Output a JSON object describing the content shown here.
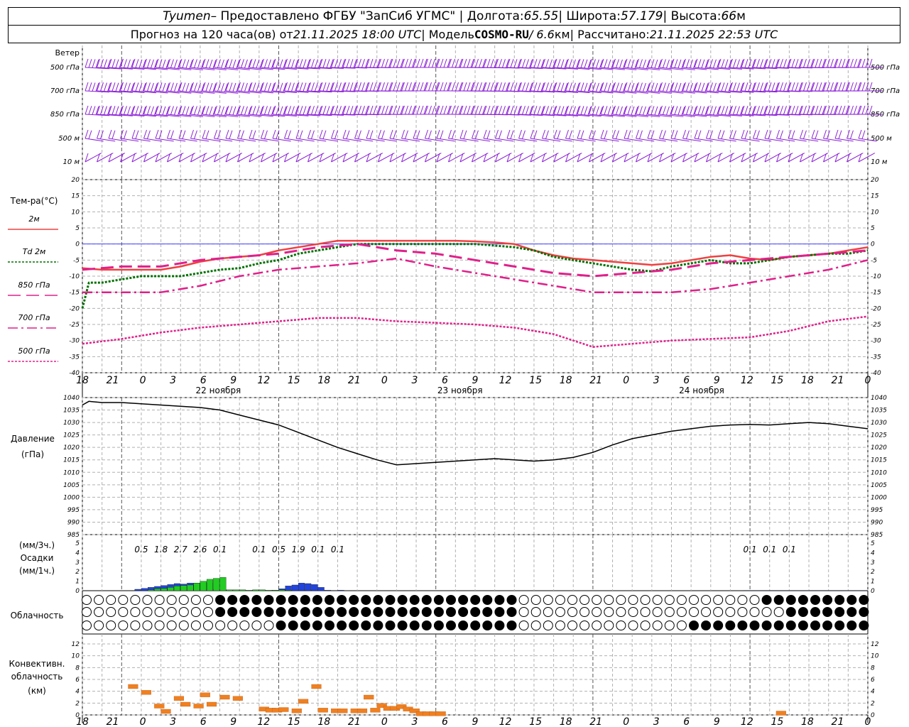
{
  "header": {
    "station": "Tyumen",
    "sep1": " – Предоставлено ФГБУ \"ЗапСиб УГМС\" | Долгота: ",
    "lon": "65.55",
    "sep2": " | Широта: ",
    "lat": "57.179",
    "sep3": " | Высота: ",
    "alt": "66",
    "alt_unit": "м",
    "fc_prefix": "Прогноз на 120 часа(ов) от ",
    "fc_time": "21.11.2025 18:00 UTC",
    "model_prefix": " | Модель ",
    "model": "COSMO-RU",
    "model_res": " / 6.6",
    "model_res_unit": "км",
    "calc_prefix": " | Рассчитано: ",
    "calc_time": "21.11.2025 22:53 UTC"
  },
  "wind_panel": {
    "title": "Ветер",
    "levels": [
      "500 гПа",
      "700 гПа",
      "850 гПа",
      "500 м",
      "10 м"
    ],
    "barb_color": "#8b1fd6"
  },
  "temp_panel": {
    "title": "Тем-ра(°C)",
    "legend": [
      "2м",
      "Td  2м",
      "850 гПа",
      "700 гПа",
      "500 гПа"
    ],
    "yticks": [
      "20",
      "15",
      "10",
      "5",
      "0",
      "-5",
      "-10",
      "-15",
      "-20",
      "-25",
      "-30",
      "-35",
      "-40"
    ]
  },
  "time_axis": {
    "hours": [
      "18",
      "21",
      "0",
      "3",
      "6",
      "9",
      "12",
      "15",
      "18",
      "21",
      "0",
      "3",
      "6",
      "9",
      "12",
      "15",
      "18",
      "21",
      "0",
      "3",
      "6",
      "9",
      "12",
      "15",
      "18",
      "21",
      "0"
    ],
    "days": [
      "22 ноября",
      "23 ноября",
      "24 ноября"
    ]
  },
  "pressure_panel": {
    "title": "Давление",
    "unit": "(гПа)",
    "yticks": [
      "1040",
      "1035",
      "1030",
      "1025",
      "1020",
      "1015",
      "1010",
      "1005",
      "1000",
      "995",
      "990",
      "985"
    ]
  },
  "precip_panel": {
    "unit_3h": "(мм/3ч.)",
    "title": "Осадки",
    "unit_1h": "(мм/1ч.)",
    "yticks": [
      "5",
      "4",
      "3",
      "2",
      "1",
      "0"
    ],
    "totals": [
      {
        "hour": 9,
        "text": "0.5"
      },
      {
        "hour": 12,
        "text": "1.8"
      },
      {
        "hour": 15,
        "text": "2.7"
      },
      {
        "hour": 18,
        "text": "2.6"
      },
      {
        "hour": 21,
        "text": "0.1"
      },
      {
        "hour": 27,
        "text": "0.1"
      },
      {
        "hour": 30,
        "text": "0.5"
      },
      {
        "hour": 33,
        "text": "1.9"
      },
      {
        "hour": 36,
        "text": "0.1"
      },
      {
        "hour": 39,
        "text": "0.1"
      },
      {
        "hour": 102,
        "text": "0.1"
      },
      {
        "hour": 105,
        "text": "0.1"
      },
      {
        "hour": 108,
        "text": "0.1"
      }
    ]
  },
  "cloud_panel": {
    "title": "Облачность"
  },
  "conv_panel": {
    "title_1": "Конвективн.",
    "title_2": "облачность",
    "unit": "(км)",
    "yticks": [
      "12",
      "10",
      "8",
      "6",
      "4",
      "2",
      "0"
    ]
  },
  "colors": {
    "t2m": "#f04040",
    "td2m": "#007000",
    "t850": "#e0208a",
    "t700": "#e0208a",
    "t500": "#e0208a",
    "zero_line": "#4040ff",
    "precip_green": "#22cc22",
    "precip_blue": "#2244dd",
    "conv": "#f08020",
    "grid": "#b0b0b0"
  },
  "chart_data": [
    {
      "type": "line",
      "title": "Тем-ра(°C)",
      "x_unit": "hours since 21.11.2025 18:00 UTC",
      "ylim": [
        -40,
        20
      ],
      "series": [
        {
          "name": "2м",
          "x": [
            0,
            3,
            6,
            9,
            12,
            15,
            18,
            21,
            24,
            27,
            30,
            33,
            36,
            39,
            42,
            45,
            48,
            51,
            54,
            57,
            60,
            63,
            66,
            69,
            72,
            75,
            78,
            81,
            84,
            87,
            90,
            93,
            96,
            99,
            102,
            105,
            108,
            111,
            114,
            117,
            120
          ],
          "values": [
            -7.5,
            -8,
            -8,
            -8,
            -8,
            -7,
            -5.5,
            -4.5,
            -4,
            -3.5,
            -2,
            -1,
            0,
            1,
            1,
            1,
            1,
            1,
            1,
            1,
            0.8,
            0.5,
            0,
            -2,
            -3.5,
            -4.5,
            -5,
            -5.5,
            -6,
            -6.5,
            -6,
            -5,
            -4,
            -3.5,
            -4.5,
            -5,
            -4,
            -3.5,
            -3,
            -2,
            -1
          ]
        },
        {
          "name": "Td  2м",
          "x": [
            0,
            1,
            3,
            6,
            9,
            12,
            15,
            18,
            21,
            24,
            27,
            30,
            33,
            36,
            39,
            42,
            45,
            48,
            51,
            54,
            57,
            60,
            63,
            66,
            69,
            72,
            75,
            78,
            81,
            84,
            87,
            90,
            93,
            96,
            99,
            102,
            105,
            108,
            111,
            114,
            117,
            120
          ],
          "values": [
            -20,
            -12,
            -12,
            -11,
            -10,
            -10,
            -10,
            -9,
            -8,
            -7.5,
            -6,
            -5,
            -3,
            -2,
            -1,
            0,
            0,
            0,
            0,
            0,
            0,
            0,
            -0.5,
            -1,
            -2,
            -4,
            -5,
            -6,
            -7,
            -8,
            -8.5,
            -7,
            -6,
            -5,
            -6,
            -6,
            -5,
            -4,
            -3.5,
            -3,
            -3,
            -2
          ]
        },
        {
          "name": "850 гПа",
          "x": [
            0,
            6,
            12,
            18,
            24,
            30,
            36,
            42,
            48,
            54,
            60,
            66,
            72,
            78,
            84,
            90,
            96,
            102,
            108,
            114,
            120
          ],
          "values": [
            -8,
            -7,
            -7,
            -5,
            -4,
            -3,
            -1,
            0,
            -2,
            -3,
            -5,
            -7,
            -9,
            -10,
            -9,
            -8,
            -6,
            -5,
            -4,
            -3,
            -2
          ]
        },
        {
          "name": "700 гПа",
          "x": [
            0,
            6,
            12,
            18,
            24,
            30,
            36,
            42,
            48,
            54,
            60,
            66,
            72,
            78,
            84,
            90,
            96,
            102,
            108,
            114,
            120
          ],
          "values": [
            -15,
            -15,
            -15,
            -13,
            -10,
            -8,
            -7,
            -6,
            -4.5,
            -7,
            -9,
            -11,
            -13,
            -15,
            -15,
            -15,
            -14,
            -12,
            -10,
            -8,
            -5
          ]
        },
        {
          "name": "500 гПа",
          "x": [
            0,
            6,
            12,
            18,
            24,
            30,
            36,
            42,
            48,
            54,
            60,
            66,
            72,
            78,
            84,
            90,
            96,
            102,
            108,
            114,
            120
          ],
          "values": [
            -31,
            -29.5,
            -27.5,
            -26,
            -25,
            -24,
            -23,
            -23,
            -24,
            -24.5,
            -25,
            -26,
            -28,
            -32,
            -31,
            -30,
            -29.5,
            -29,
            -27,
            -24,
            -22.5
          ]
        }
      ]
    },
    {
      "type": "line",
      "title": "Давление",
      "ylabel": "(гПа)",
      "x_unit": "hours since 21.11.2025 18:00 UTC",
      "ylim": [
        985,
        1040
      ],
      "series": [
        {
          "name": "",
          "x": [
            0,
            1,
            3,
            6,
            9,
            12,
            15,
            18,
            21,
            24,
            27,
            30,
            33,
            36,
            39,
            42,
            45,
            48,
            51,
            54,
            57,
            60,
            63,
            66,
            69,
            72,
            75,
            78,
            81,
            84,
            87,
            90,
            93,
            96,
            99,
            102,
            105,
            108,
            111,
            114,
            117,
            120
          ],
          "values": [
            1037,
            1038.5,
            1038,
            1038,
            1037.5,
            1037,
            1036.5,
            1036,
            1035,
            1033,
            1031,
            1029,
            1026,
            1023,
            1020,
            1017.5,
            1015,
            1013,
            1013.5,
            1014,
            1014.5,
            1015,
            1015.5,
            1015,
            1014.5,
            1015,
            1016,
            1018,
            1021,
            1023.5,
            1025,
            1026.5,
            1027.5,
            1028.5,
            1029,
            1029.2,
            1029,
            1029.5,
            1030,
            1029.5,
            1028.5,
            1027.5
          ]
        }
      ]
    },
    {
      "type": "bar",
      "title": "Осадки",
      "ylabel": "(мм/1ч.)",
      "x_unit": "hours since 21.11.2025 18:00 UTC",
      "ylim": [
        0,
        5
      ],
      "series": [
        {
          "name": "",
          "color": "#2244dd",
          "x": [
            9,
            10,
            11,
            12,
            13,
            14,
            15,
            16,
            17,
            18,
            19,
            20,
            21,
            22,
            23,
            24,
            25,
            26,
            27,
            28,
            29,
            30,
            31,
            32,
            33,
            34,
            35,
            36,
            37,
            38,
            39,
            40,
            102,
            103,
            104,
            105,
            106,
            107,
            108,
            109,
            110,
            111,
            112,
            113,
            114,
            115,
            116,
            117,
            118,
            119,
            120
          ],
          "values": [
            0.15,
            0.25,
            0.35,
            0.45,
            0.55,
            0.65,
            0.75,
            0.7,
            0.8,
            0.8,
            0.9,
            0.8,
            0.15,
            0.05,
            0.05,
            0.05,
            0.03,
            0,
            0.05,
            0.03,
            0,
            0.05,
            0.2,
            0.5,
            0.6,
            0.8,
            0.75,
            0.65,
            0.35,
            0.05,
            0.03,
            0.05,
            0.03,
            0.03,
            0.03,
            0.03,
            0.03,
            0.03,
            0.03,
            0.03,
            0.03,
            0.03,
            0.03,
            0.03,
            0.03,
            0.03,
            0.03,
            0.03,
            0.03,
            0.03,
            0.03
          ]
        },
        {
          "name": "",
          "color": "#22cc22",
          "x": [
            11,
            12,
            13,
            14,
            15,
            16,
            17,
            18,
            19,
            20,
            21,
            22,
            23,
            24,
            25,
            26,
            27,
            28,
            29,
            30,
            31,
            32
          ],
          "values": [
            0.1,
            0.2,
            0.25,
            0.35,
            0.5,
            0.55,
            0.6,
            0.8,
            1.0,
            1.2,
            1.3,
            1.4,
            0.1,
            0.1,
            0.1,
            0.05,
            0.1,
            0.1,
            0.05,
            0.05,
            0.1,
            0.05
          ]
        }
      ]
    },
    {
      "type": "bar",
      "title": "Конвективн. облачность",
      "ylabel": "(км)",
      "x_unit": "hours since 21.11.2025 18:00 UTC",
      "ylim": [
        0,
        13
      ],
      "series": [
        {
          "name": "",
          "x": [
            7,
            9,
            11,
            12,
            14,
            15,
            17,
            18,
            19,
            21,
            23,
            27,
            28,
            29,
            30,
            32,
            33,
            35,
            36,
            38,
            39,
            41,
            42,
            43,
            44,
            45,
            46,
            47,
            48,
            49,
            50,
            51,
            52,
            53,
            54,
            106
          ],
          "values": [
            4.8,
            3.8,
            1.5,
            0.6,
            2.8,
            1.8,
            1.5,
            3.4,
            1.8,
            3.0,
            2.8,
            1.0,
            0.8,
            0.8,
            0.9,
            0.7,
            2.3,
            4.8,
            0.8,
            0.7,
            0.7,
            0.7,
            0.7,
            3.0,
            0.8,
            1.6,
            1.1,
            1.1,
            1.4,
            1.0,
            0.7,
            0.2,
            0.2,
            0.2,
            0.2,
            0.3
          ]
        }
      ]
    }
  ]
}
